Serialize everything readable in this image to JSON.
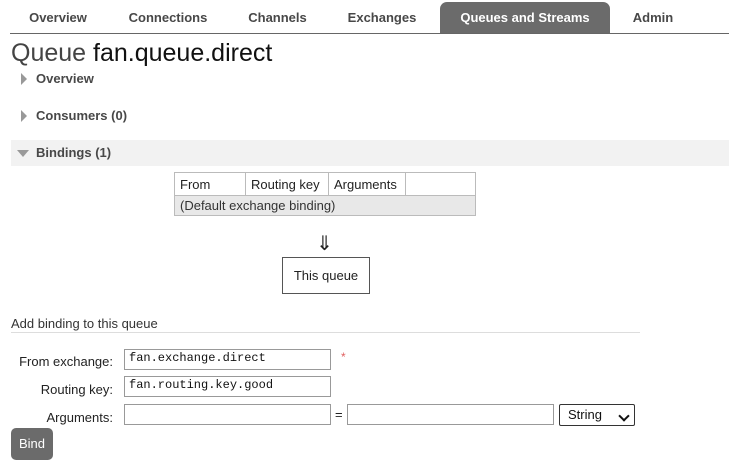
{
  "tabs": [
    "Overview",
    "Connections",
    "Channels",
    "Exchanges",
    "Queues and Streams",
    "Admin"
  ],
  "active_tab": "Queues and Streams",
  "page_title": {
    "prefix": "Queue",
    "name": "fan.queue.direct"
  },
  "sections": {
    "overview": "Overview",
    "consumers": "Consumers (0)",
    "bindings": "Bindings (1)"
  },
  "bindings_table": {
    "headers": [
      "From",
      "Routing key",
      "Arguments",
      ""
    ],
    "rows": [
      [
        "(Default exchange binding)"
      ]
    ]
  },
  "flow": {
    "arrow": "⇓",
    "this_queue": "This queue"
  },
  "add_binding": {
    "title": "Add binding to this queue",
    "from_exchange_label": "From exchange:",
    "from_exchange_value": "fan.exchange.direct",
    "required_mark": "*",
    "routing_key_label": "Routing key:",
    "routing_key_value": "fan.routing.key.good",
    "arguments_label": "Arguments:",
    "argument_key_value": "",
    "equals": "=",
    "argument_value_value": "",
    "type_select": "String",
    "bind_button": "Bind"
  }
}
